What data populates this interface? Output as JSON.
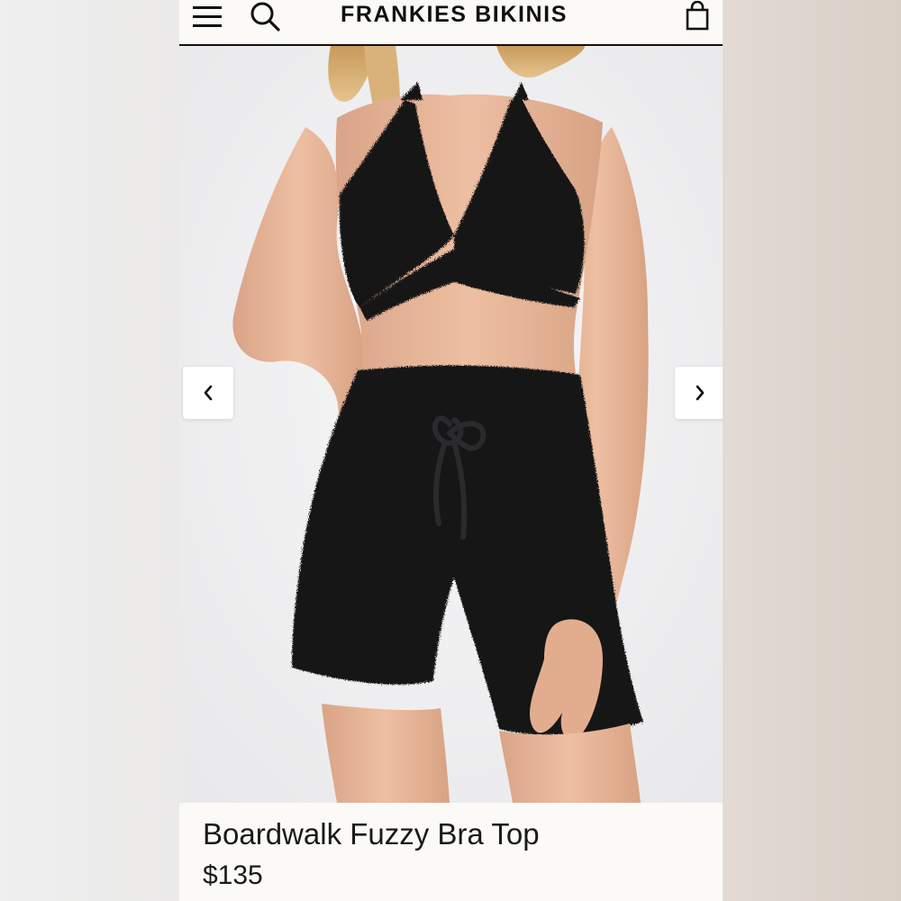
{
  "header": {
    "brand": "FRANKIES BIKINIS",
    "menu_icon": "hamburger-menu-icon",
    "search_icon": "search-icon",
    "cart_icon": "shopping-bag-icon"
  },
  "gallery": {
    "image_alt": "Model wearing black fuzzy bra top and shorts",
    "prev_icon": "chevron-left-icon",
    "next_icon": "chevron-right-icon"
  },
  "product": {
    "title": "Boardwalk Fuzzy Bra Top",
    "price": "$135"
  },
  "colors": {
    "page_bg": "#fbfaf7",
    "text": "#111111",
    "garment": "#141416"
  }
}
